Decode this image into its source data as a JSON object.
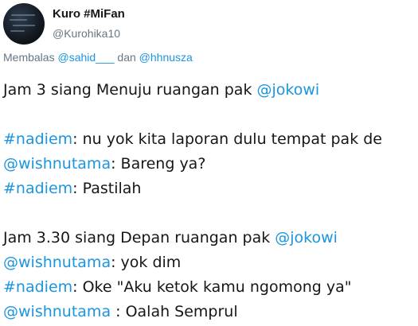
{
  "tweet": {
    "author": {
      "display_name": "Kuro #MiFan",
      "handle": "@Kurohika10",
      "avatar_icon": "avatar-image"
    },
    "reply": {
      "prefix": "Membalas",
      "mention1": "@sahid___",
      "conjunction": "dan",
      "mention2": "@hhnusza"
    },
    "lines": [
      {
        "parts": [
          {
            "t": "Jam 3 siang Menuju ruangan pak "
          },
          {
            "t": "@jokowi",
            "k": "mention"
          }
        ]
      },
      {
        "parts": []
      },
      {
        "parts": [
          {
            "t": "#nadiem",
            "k": "hashtag"
          },
          {
            "t": ": nu yok kita laporan dulu tempat pak de"
          }
        ]
      },
      {
        "parts": [
          {
            "t": "@wishnutama",
            "k": "mention"
          },
          {
            "t": ": Bareng ya?"
          }
        ]
      },
      {
        "parts": [
          {
            "t": "#nadiem",
            "k": "hashtag"
          },
          {
            "t": ": Pastilah"
          }
        ]
      },
      {
        "parts": []
      },
      {
        "parts": [
          {
            "t": "Jam 3.30 siang Depan ruangan pak "
          },
          {
            "t": "@jokowi",
            "k": "mention"
          }
        ]
      },
      {
        "parts": [
          {
            "t": "@wishnutama",
            "k": "mention"
          },
          {
            "t": ": yok dim"
          }
        ]
      },
      {
        "parts": [
          {
            "t": "#nadiem",
            "k": "hashtag"
          },
          {
            "t": ": Oke \"Aku ketok kamu ngomong ya\""
          }
        ]
      },
      {
        "parts": [
          {
            "t": "@wishnutama",
            "k": "mention"
          },
          {
            "t": " : Oalah Semprul"
          }
        ]
      }
    ]
  },
  "colors": {
    "link": "#1b95e0",
    "text": "#14171a",
    "secondary": "#657786"
  }
}
